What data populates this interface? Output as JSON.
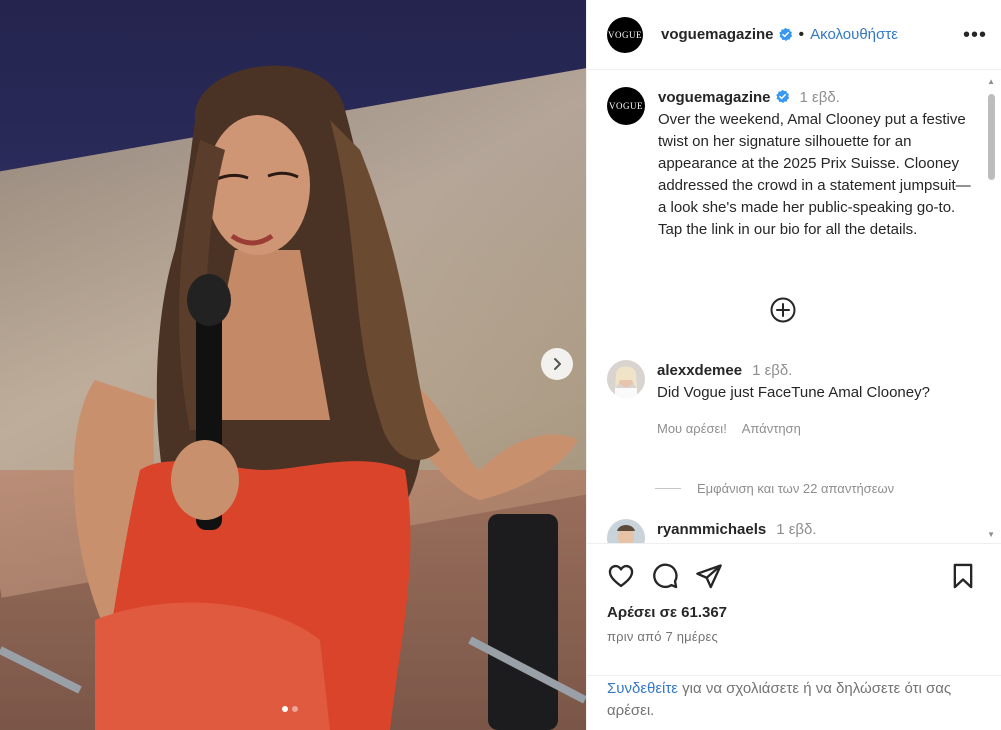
{
  "post": {
    "username": "voguemagazine",
    "avatar_text": "VOGUE",
    "follow_label": "Ακολουθήστε",
    "more_label": "•••",
    "caption_time": "1 εβδ.",
    "caption": "Over the weekend, Amal Clooney put a festive twist on her signature silhouette for an appearance at the 2025 Prix Suisse. Clooney addressed the crowd in a statement jumpsuit—a look she's made her public-speaking go-to. Tap the link in our bio for all the details.",
    "image_count": 2,
    "image_index": 1
  },
  "comments": [
    {
      "username": "alexxdemee",
      "time": "1 εβδ.",
      "text": "Did Vogue just FaceTune Amal Clooney?",
      "like_label": "Μου αρέσει!",
      "reply_label": "Απάντηση",
      "view_replies": "Εμφάνιση και των 22 απαντήσεων"
    },
    {
      "username": "ryanmmichaels",
      "time": "1 εβδ."
    }
  ],
  "engagement": {
    "likes": "Αρέσει σε 61.367",
    "date": "πριν από 7 ημέρες"
  },
  "login_prompt": {
    "link": "Συνδεθείτε",
    "rest": " για να σχολιάσετε ή να δηλώσετε ότι σας αρέσει."
  },
  "colors": {
    "accent": "#3478c6",
    "dress": "#d9442b",
    "verified": "#3897f0"
  },
  "icons": [
    "verified-badge-icon",
    "more-icon",
    "add-comment-icon",
    "heart-icon",
    "comment-icon",
    "share-icon",
    "bookmark-icon",
    "chevron-right-icon"
  ]
}
